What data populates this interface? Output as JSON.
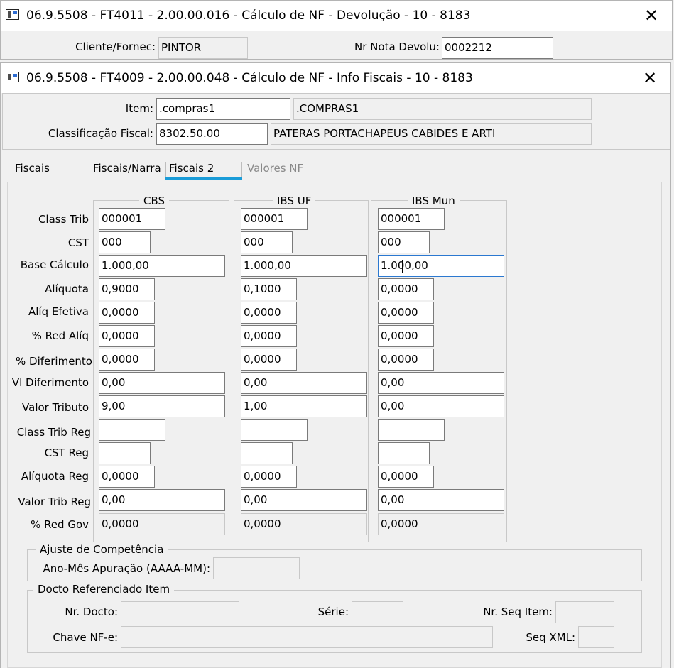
{
  "window1": {
    "title": "06.9.5508 - FT4011 - 2.00.00.016 - Cálculo de NF - Devolução - 10 - 8183",
    "close_glyph": "✕",
    "cliente_label": "Cliente/Fornec:",
    "cliente_value": "PINTOR",
    "nota_label": "Nr Nota Devolu:",
    "nota_value": "0002212"
  },
  "window2": {
    "title": "06.9.5508 - FT4009 - 2.00.00.048 - Cálculo de NF - Info Fiscais - 10 - 8183",
    "close_glyph": "✕",
    "item_label": "Item:",
    "item_value": ".compras1",
    "item_desc": ".COMPRAS1",
    "class_label": "Classificação Fiscal:",
    "class_value": "8302.50.00",
    "class_desc": "PATERAS PORTACHAPEUS CABIDES E ARTI"
  },
  "tabs": [
    "Fiscais",
    "Fiscais/Narra",
    "Fiscais 2",
    "Valores NF"
  ],
  "active_tab": "Fiscais 2",
  "rows": {
    "class_trib": "Class Trib",
    "cst": "CST",
    "base_calculo": "Base Cálculo",
    "aliquota": "Alíquota",
    "aliq_efetiva": "Alíq Efetiva",
    "red_aliq": "% Red Alíq",
    "diferimento": "% Diferimento",
    "vl_diferimento": "Vl Diferimento",
    "valor_tributo": "Valor Tributo",
    "class_trib_reg": "Class Trib Reg",
    "cst_reg": "CST Reg",
    "aliquota_reg": "Alíquota Reg",
    "valor_trib_reg": "Valor Trib Reg",
    "red_gov": "% Red Gov"
  },
  "cbs": {
    "title": "CBS",
    "class_trib": "000001",
    "cst": "000",
    "base_calculo": "1.000,00",
    "aliquota": "0,9000",
    "aliq_efetiva": "0,0000",
    "red_aliq": "0,0000",
    "diferimento": "0,0000",
    "vl_diferimento": "0,00",
    "valor_tributo": "9,00",
    "class_trib_reg": "",
    "cst_reg": "",
    "aliquota_reg": "0,0000",
    "valor_trib_reg": "0,00",
    "red_gov": "0,0000"
  },
  "ibs_uf": {
    "title": "IBS UF",
    "class_trib": "000001",
    "cst": "000",
    "base_calculo": "1.000,00",
    "aliquota": "0,1000",
    "aliq_efetiva": "0,0000",
    "red_aliq": "0,0000",
    "diferimento": "0,0000",
    "vl_diferimento": "0,00",
    "valor_tributo": "1,00",
    "class_trib_reg": "",
    "cst_reg": "",
    "aliquota_reg": "0,0000",
    "valor_trib_reg": "0,00",
    "red_gov": "0,0000"
  },
  "ibs_mun": {
    "title": "IBS Mun",
    "class_trib": "000001",
    "cst": "000",
    "base_calculo": "1.000,00",
    "aliquota": "0,0000",
    "aliq_efetiva": "0,0000",
    "red_aliq": "0,0000",
    "diferimento": "0,0000",
    "vl_diferimento": "0,00",
    "valor_tributo": "0,00",
    "class_trib_reg": "",
    "cst_reg": "",
    "aliquota_reg": "0,0000",
    "valor_trib_reg": "0,00",
    "red_gov": "0,0000"
  },
  "ajuste": {
    "title": "Ajuste de Competência",
    "ano_mes_label": "Ano-Mês Apuração (AAAA-MM):",
    "ano_mes_value": ""
  },
  "docto": {
    "title": "Docto Referenciado Item",
    "nr_docto_label": "Nr. Docto:",
    "nr_docto_value": "",
    "serie_label": "Série:",
    "serie_value": "",
    "nr_seq_label": "Nr. Seq Item:",
    "nr_seq_value": "",
    "chave_label": "Chave NF-e:",
    "chave_value": "",
    "seq_xml_label": "Seq XML:",
    "seq_xml_value": ""
  }
}
